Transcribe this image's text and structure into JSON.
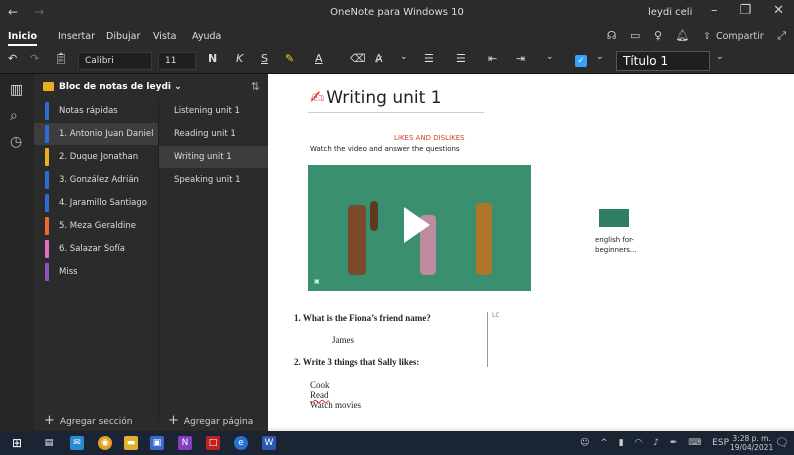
{
  "window": {
    "title": "OneNote para Windows 10",
    "user": "leydi celi"
  },
  "menu": {
    "items": [
      "Inicio",
      "Insertar",
      "Dibujar",
      "Vista",
      "Ayuda"
    ],
    "share_label": "Compartir"
  },
  "ribbon": {
    "font_name": "Calibri",
    "font_size": "11",
    "bold": "N",
    "italic": "K",
    "underline": "S",
    "style": "Título 1"
  },
  "notebook": {
    "name": "Bloc de notas de leydi",
    "sections": [
      {
        "label": "Notas rápidas",
        "color": "#2f6bd6"
      },
      {
        "label": "1. Antonio Juan Daniel",
        "color": "#2f6bd6"
      },
      {
        "label": "2. Duque Jonathan",
        "color": "#e8b020"
      },
      {
        "label": "3. González Adrián",
        "color": "#2f6bd6"
      },
      {
        "label": "4. Jaramillo Santiago",
        "color": "#2f6bd6"
      },
      {
        "label": "5. Meza Geraldine",
        "color": "#e86b30"
      },
      {
        "label": "6. Salazar Sofía",
        "color": "#e070c0"
      },
      {
        "label": "Miss",
        "color": "#9050c0"
      }
    ],
    "pages": [
      "Listening unit 1",
      "Reading unit 1",
      "Writing unit 1",
      "Speaking unit 1"
    ],
    "add_section": "Agregar sección",
    "add_page": "Agregar página"
  },
  "page": {
    "title": "Writing unit 1",
    "subheading": "LIKES AND DISLIKES",
    "instruction": "Watch the video and answer the questions",
    "video_caption": "english for-\nbeginners...",
    "q1": "1.   What is the Fiona’s friend name?",
    "a1": "James",
    "q2": "2.   Write 3 things that Sally likes:",
    "a2": [
      "Cook",
      "Read",
      "Watch movies"
    ],
    "side_note": "LC"
  },
  "taskbar": {
    "language": "ESP",
    "time": "3:28 p. m.",
    "date": "19/04/2021"
  }
}
